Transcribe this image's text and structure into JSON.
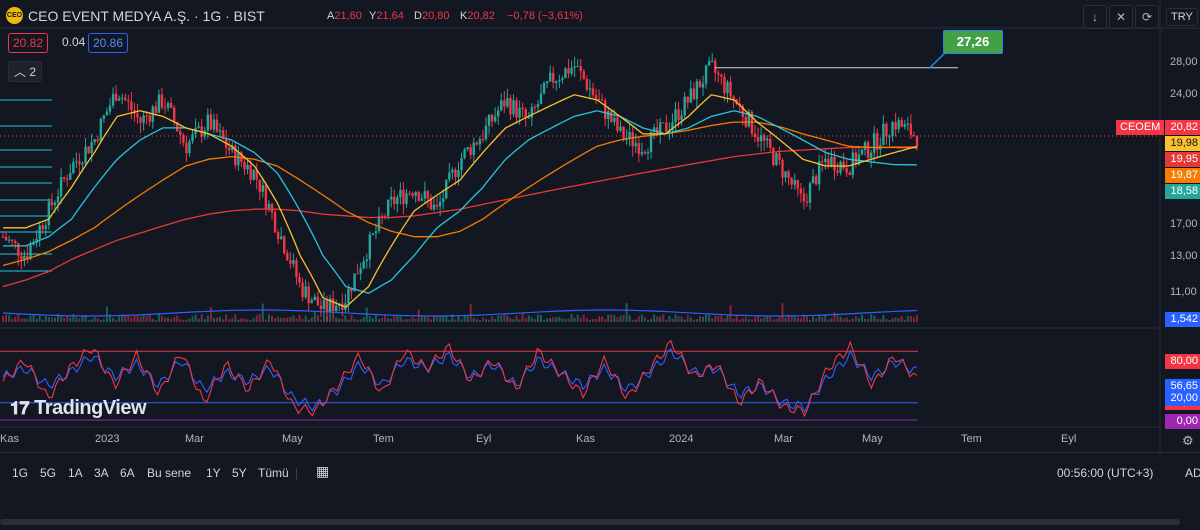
{
  "header": {
    "logo_text": "CEO",
    "title": "CEO EVENT MEDYA A.Ş. · 1G · BIST",
    "ohlc": {
      "a_label": "A",
      "a": "21,60",
      "y_label": "Y",
      "y": "21,64",
      "d_label": "D",
      "d": "20,80",
      "k_label": "K",
      "k": "20,82",
      "change": "−0,78 (−3,61%)"
    },
    "sell_price": "20.82",
    "spread": "0.04",
    "buy_price": "20.86",
    "indicators_toggle": "2",
    "currency": "TRY"
  },
  "toolbar": {
    "btn_down": "↓",
    "btn_close": "✕",
    "btn_refresh": "⟳",
    "btn_expand": "⛶"
  },
  "icons": {
    "down": "arrow-down-icon",
    "close": "close-icon",
    "refresh": "refresh-icon",
    "expand": "expand-icon",
    "calendar": "calendar-range-icon",
    "settings": "settings-icon"
  },
  "price_axis": {
    "labels": [
      "28,00",
      "24,00",
      "17,00",
      "13,00",
      "11,00"
    ],
    "symbol_tag": "CEOEM",
    "tags": [
      {
        "value": "20,82",
        "color": "#f23645"
      },
      {
        "value": "19,98",
        "color": "#fbc02d"
      },
      {
        "value": "19,95",
        "color": "#e53935"
      },
      {
        "value": "19,87",
        "color": "#f57c00"
      },
      {
        "value": "18,58",
        "color": "#26a69a"
      },
      {
        "value": "1,542",
        "color": "#2962ff"
      }
    ]
  },
  "rsi_axis": {
    "tags": [
      {
        "value": "80,00",
        "color": "#f23645"
      },
      {
        "value": "56,65",
        "color": "#2962ff"
      },
      {
        "value": "47,17",
        "color": "#f23645"
      },
      {
        "value": "20,00",
        "color": "#2962ff"
      },
      {
        "value": "0,00",
        "color": "#9c27b0"
      }
    ]
  },
  "annotation": {
    "label": "27,26"
  },
  "time_axis": [
    "Kas",
    "2023",
    "Mar",
    "May",
    "Tem",
    "Eyl",
    "Kas",
    "2024",
    "Mar",
    "May",
    "Tem",
    "Eyl"
  ],
  "watermark": "TradingView",
  "ranges": [
    "1G",
    "5G",
    "1A",
    "3A",
    "6A",
    "Bu sene",
    "1Y",
    "5Y",
    "Tümü"
  ],
  "status": {
    "clock": "00:56:00 (UTC+3)",
    "adj": "AD"
  },
  "colors": {
    "background": "#131722",
    "up": "#26a69a",
    "down": "#f23645",
    "ma_fast": "#fbc02d",
    "ma_mid": "#26c6da",
    "ma_slow": "#f57c00",
    "ma_long": "#e53935",
    "rsi_fast": "#f23645",
    "rsi_slow": "#2962ff"
  },
  "chart_data": {
    "type": "candlestick",
    "title": "CEO EVENT MEDYA A.Ş. · 1G · BIST",
    "x_range": [
      "2022-11",
      "2024-05"
    ],
    "ylim": [
      10,
      29
    ],
    "log_scale": true,
    "price_path": [
      14.0,
      13.0,
      15.5,
      18.5,
      20.5,
      25.0,
      22.0,
      24.0,
      20.0,
      22.0,
      19.5,
      18.0,
      14.5,
      11.5,
      10.5,
      11.0,
      13.5,
      16.0,
      17.0,
      15.5,
      19.0,
      21.0,
      24.0,
      22.0,
      26.0,
      27.5,
      24.0,
      21.0,
      20.0,
      21.5,
      24.0,
      27.26,
      24.0,
      21.0,
      18.5,
      16.0,
      19.0,
      18.5,
      20.0,
      22.0,
      20.82
    ],
    "ma_fast_path": [
      14.5,
      14.5,
      15.0,
      17.0,
      19.5,
      22.5,
      23.0,
      22.5,
      21.5,
      21.0,
      20.0,
      18.5,
      16.0,
      13.0,
      11.0,
      10.6,
      11.5,
      13.5,
      15.5,
      16.5,
      17.5,
      19.5,
      21.5,
      22.5,
      23.5,
      24.5,
      24.0,
      22.5,
      21.0,
      21.0,
      22.5,
      24.5,
      24.0,
      22.0,
      20.5,
      19.0,
      18.5,
      18.5,
      19.0,
      19.5,
      19.98
    ],
    "ma_mid_path": [
      13.5,
      13.5,
      14.0,
      15.0,
      17.0,
      19.0,
      20.5,
      21.5,
      21.5,
      21.0,
      20.5,
      19.5,
      18.0,
      15.5,
      13.0,
      11.5,
      11.2,
      11.8,
      13.0,
      14.5,
      15.5,
      17.0,
      19.0,
      20.5,
      21.5,
      22.5,
      23.0,
      22.5,
      21.5,
      21.0,
      21.5,
      22.5,
      23.0,
      22.5,
      21.5,
      20.5,
      19.5,
      19.0,
      18.8,
      18.6,
      18.58
    ],
    "ma_slow_path": [
      12.5,
      12.8,
      13.2,
      13.8,
      14.5,
      15.5,
      16.5,
      17.5,
      18.5,
      19.0,
      19.2,
      19.0,
      18.5,
      17.5,
      16.5,
      15.5,
      14.8,
      14.3,
      14.0,
      14.0,
      14.3,
      15.0,
      16.0,
      17.0,
      18.0,
      19.0,
      20.0,
      20.5,
      20.8,
      21.0,
      21.3,
      21.7,
      22.0,
      22.0,
      21.6,
      21.0,
      20.5,
      20.0,
      19.9,
      19.9,
      19.87
    ],
    "ma_long_path": [
      11.5,
      11.8,
      12.2,
      12.8,
      13.3,
      13.8,
      14.2,
      14.6,
      15.0,
      15.3,
      15.5,
      15.6,
      15.6,
      15.5,
      15.3,
      15.2,
      15.1,
      15.1,
      15.2,
      15.4,
      15.6,
      15.9,
      16.2,
      16.5,
      16.8,
      17.1,
      17.4,
      17.7,
      18.0,
      18.3,
      18.6,
      18.9,
      19.2,
      19.4,
      19.6,
      19.7,
      19.8,
      19.9,
      19.9,
      19.95,
      19.95
    ],
    "volume_last": "1,542",
    "rsi": {
      "levels": [
        80,
        20,
        0
      ],
      "fast": [
        45,
        70,
        25,
        60,
        85,
        40,
        75,
        30,
        80,
        20,
        65,
        35,
        70,
        15,
        10,
        40,
        75,
        30,
        80,
        60,
        85,
        45,
        70,
        35,
        80,
        55,
        30,
        70,
        25,
        60,
        90,
        50,
        65,
        20,
        45,
        15,
        10,
        60,
        85,
        40,
        75,
        47.17
      ],
      "slow": [
        50,
        60,
        40,
        55,
        75,
        50,
        65,
        40,
        70,
        35,
        55,
        45,
        60,
        25,
        15,
        35,
        65,
        40,
        70,
        60,
        75,
        50,
        65,
        40,
        70,
        55,
        40,
        60,
        35,
        55,
        80,
        55,
        60,
        30,
        40,
        20,
        15,
        50,
        75,
        50,
        68,
        56.65
      ]
    }
  }
}
